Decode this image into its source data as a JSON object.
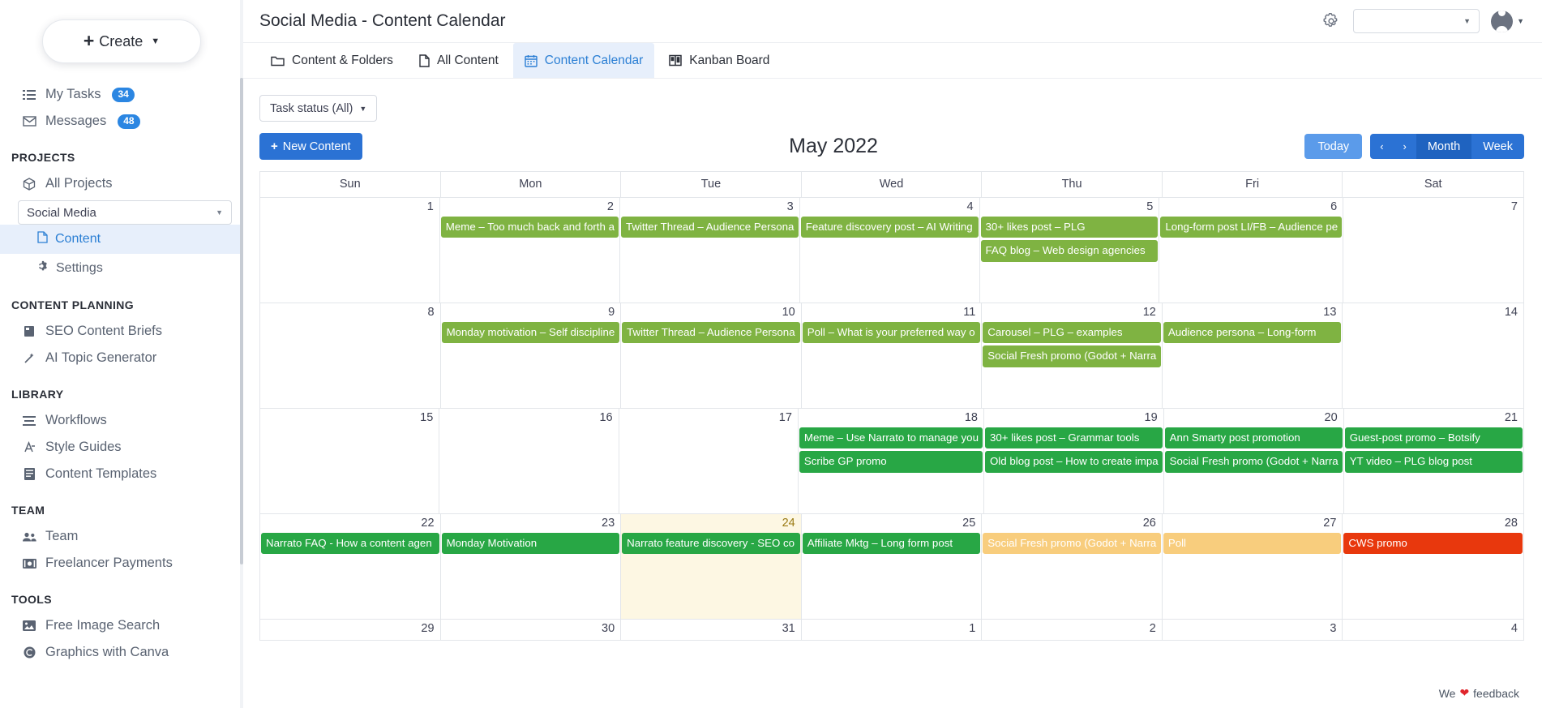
{
  "sidebar": {
    "create_label": "Create",
    "nav": [
      {
        "label": "My Tasks",
        "badge": "34",
        "icon": "tasks-icon"
      },
      {
        "label": "Messages",
        "badge": "48",
        "icon": "envelope-icon"
      }
    ],
    "projects_heading": "PROJECTS",
    "all_projects_label": "All Projects",
    "project_select_value": "Social Media",
    "project_items": [
      {
        "label": "Content",
        "icon": "document-icon",
        "active": true
      },
      {
        "label": "Settings",
        "icon": "gear-icon",
        "active": false
      }
    ],
    "content_planning_heading": "CONTENT PLANNING",
    "content_planning_items": [
      {
        "label": "SEO Content Briefs",
        "icon": "book-icon"
      },
      {
        "label": "AI Topic Generator",
        "icon": "magic-wand-icon"
      }
    ],
    "library_heading": "LIBRARY",
    "library_items": [
      {
        "label": "Workflows",
        "icon": "workflow-icon"
      },
      {
        "label": "Style Guides",
        "icon": "style-guide-icon"
      },
      {
        "label": "Content Templates",
        "icon": "templates-icon"
      }
    ],
    "team_heading": "TEAM",
    "team_items": [
      {
        "label": "Team",
        "icon": "people-icon"
      },
      {
        "label": "Freelancer Payments",
        "icon": "payment-icon"
      }
    ],
    "tools_heading": "TOOLS",
    "tools_items": [
      {
        "label": "Free Image Search",
        "icon": "image-icon"
      },
      {
        "label": "Graphics with Canva",
        "icon": "canva-icon"
      }
    ]
  },
  "header": {
    "title": "Social Media - Content Calendar",
    "gear_icon": "gear-icon",
    "workspace_select_value": "",
    "avatar_icon": "user-avatar-icon"
  },
  "tabs": [
    {
      "label": "Content & Folders",
      "icon": "folder-icon",
      "active": false
    },
    {
      "label": "All Content",
      "icon": "document-icon",
      "active": false
    },
    {
      "label": "Content Calendar",
      "icon": "calendar-icon",
      "active": true
    },
    {
      "label": "Kanban Board",
      "icon": "kanban-icon",
      "active": false
    }
  ],
  "toolbar": {
    "filter_label": "Task status (All)",
    "new_content_label": "New Content",
    "today_label": "Today",
    "prev_label": "‹",
    "next_label": "›",
    "month_label": "Month",
    "week_label": "Week"
  },
  "calendar": {
    "title": "May 2022",
    "weekday_headers": [
      "Sun",
      "Mon",
      "Tue",
      "Wed",
      "Thu",
      "Fri",
      "Sat"
    ],
    "weeks": [
      {
        "days": [
          {
            "num": "1",
            "today": false,
            "events": []
          },
          {
            "num": "2",
            "today": false,
            "events": [
              {
                "title": "Meme – Too much back and forth a",
                "color": "olive"
              }
            ]
          },
          {
            "num": "3",
            "today": false,
            "events": [
              {
                "title": "Twitter Thread – Audience Persona",
                "color": "olive"
              }
            ]
          },
          {
            "num": "4",
            "today": false,
            "events": [
              {
                "title": "Feature discovery post – AI Writing",
                "color": "olive"
              }
            ]
          },
          {
            "num": "5",
            "today": false,
            "events": [
              {
                "title": "30+ likes post – PLG",
                "color": "olive"
              },
              {
                "title": "FAQ blog – Web design agencies",
                "color": "olive"
              }
            ]
          },
          {
            "num": "6",
            "today": false,
            "events": [
              {
                "title": "Long-form post LI/FB – Audience pe",
                "color": "olive"
              }
            ]
          },
          {
            "num": "7",
            "today": false,
            "events": []
          }
        ]
      },
      {
        "days": [
          {
            "num": "8",
            "today": false,
            "events": []
          },
          {
            "num": "9",
            "today": false,
            "events": [
              {
                "title": "Monday motivation – Self discipline",
                "color": "olive"
              }
            ]
          },
          {
            "num": "10",
            "today": false,
            "events": [
              {
                "title": "Twitter Thread – Audience Persona",
                "color": "olive"
              }
            ]
          },
          {
            "num": "11",
            "today": false,
            "events": [
              {
                "title": "Poll – What is your preferred way o",
                "color": "olive"
              }
            ]
          },
          {
            "num": "12",
            "today": false,
            "events": [
              {
                "title": "Carousel – PLG – examples",
                "color": "olive"
              },
              {
                "title": "Social Fresh promo (Godot + Narra",
                "color": "olive"
              }
            ]
          },
          {
            "num": "13",
            "today": false,
            "events": [
              {
                "title": "Audience persona – Long-form",
                "color": "olive"
              }
            ]
          },
          {
            "num": "14",
            "today": false,
            "events": []
          }
        ]
      },
      {
        "days": [
          {
            "num": "15",
            "today": false,
            "events": []
          },
          {
            "num": "16",
            "today": false,
            "events": []
          },
          {
            "num": "17",
            "today": false,
            "events": []
          },
          {
            "num": "18",
            "today": false,
            "events": [
              {
                "title": "Meme – Use Narrato to manage you",
                "color": "green"
              },
              {
                "title": "Scribe GP promo",
                "color": "green"
              }
            ]
          },
          {
            "num": "19",
            "today": false,
            "events": [
              {
                "title": "30+ likes post – Grammar tools",
                "color": "green"
              },
              {
                "title": "Old blog post – How to create impa",
                "color": "green"
              }
            ]
          },
          {
            "num": "20",
            "today": false,
            "events": [
              {
                "title": "Ann Smarty post promotion",
                "color": "green"
              },
              {
                "title": "Social Fresh promo (Godot + Narra",
                "color": "green"
              }
            ]
          },
          {
            "num": "21",
            "today": false,
            "events": [
              {
                "title": "Guest-post promo – Botsify",
                "color": "green"
              },
              {
                "title": "YT video – PLG blog post",
                "color": "green"
              }
            ]
          }
        ]
      },
      {
        "days": [
          {
            "num": "22",
            "today": false,
            "events": [
              {
                "title": "Narrato FAQ - How a content agen",
                "color": "green"
              }
            ]
          },
          {
            "num": "23",
            "today": false,
            "events": [
              {
                "title": "Monday Motivation",
                "color": "green"
              }
            ]
          },
          {
            "num": "24",
            "today": true,
            "events": [
              {
                "title": "Narrato feature discovery - SEO co",
                "color": "green"
              }
            ]
          },
          {
            "num": "25",
            "today": false,
            "events": [
              {
                "title": "Affiliate Mktg – Long form post",
                "color": "green"
              }
            ]
          },
          {
            "num": "26",
            "today": false,
            "events": [
              {
                "title": "Social Fresh promo (Godot + Narra",
                "color": "amber"
              }
            ]
          },
          {
            "num": "27",
            "today": false,
            "events": [
              {
                "title": "Poll",
                "color": "amber"
              }
            ]
          },
          {
            "num": "28",
            "today": false,
            "events": [
              {
                "title": "CWS promo",
                "color": "red"
              }
            ]
          }
        ]
      },
      {
        "days": [
          {
            "num": "29",
            "today": false,
            "events": []
          },
          {
            "num": "30",
            "today": false,
            "events": []
          },
          {
            "num": "31",
            "today": false,
            "events": []
          },
          {
            "num": "1",
            "today": false,
            "events": []
          },
          {
            "num": "2",
            "today": false,
            "events": []
          },
          {
            "num": "3",
            "today": false,
            "events": []
          },
          {
            "num": "4",
            "today": false,
            "events": []
          }
        ]
      }
    ]
  },
  "feedback": {
    "pre": "We",
    "heart": "❤",
    "post": "feedback"
  },
  "colors": {
    "primary": "#2b72d4",
    "today_blue": "#5b9bea",
    "event_olive": "#7fb342",
    "event_green": "#28a745",
    "event_amber": "#f8cd7d",
    "event_red": "#e8380d",
    "today_cell": "#fdf7e3",
    "badge_blue": "#2b86e2"
  }
}
